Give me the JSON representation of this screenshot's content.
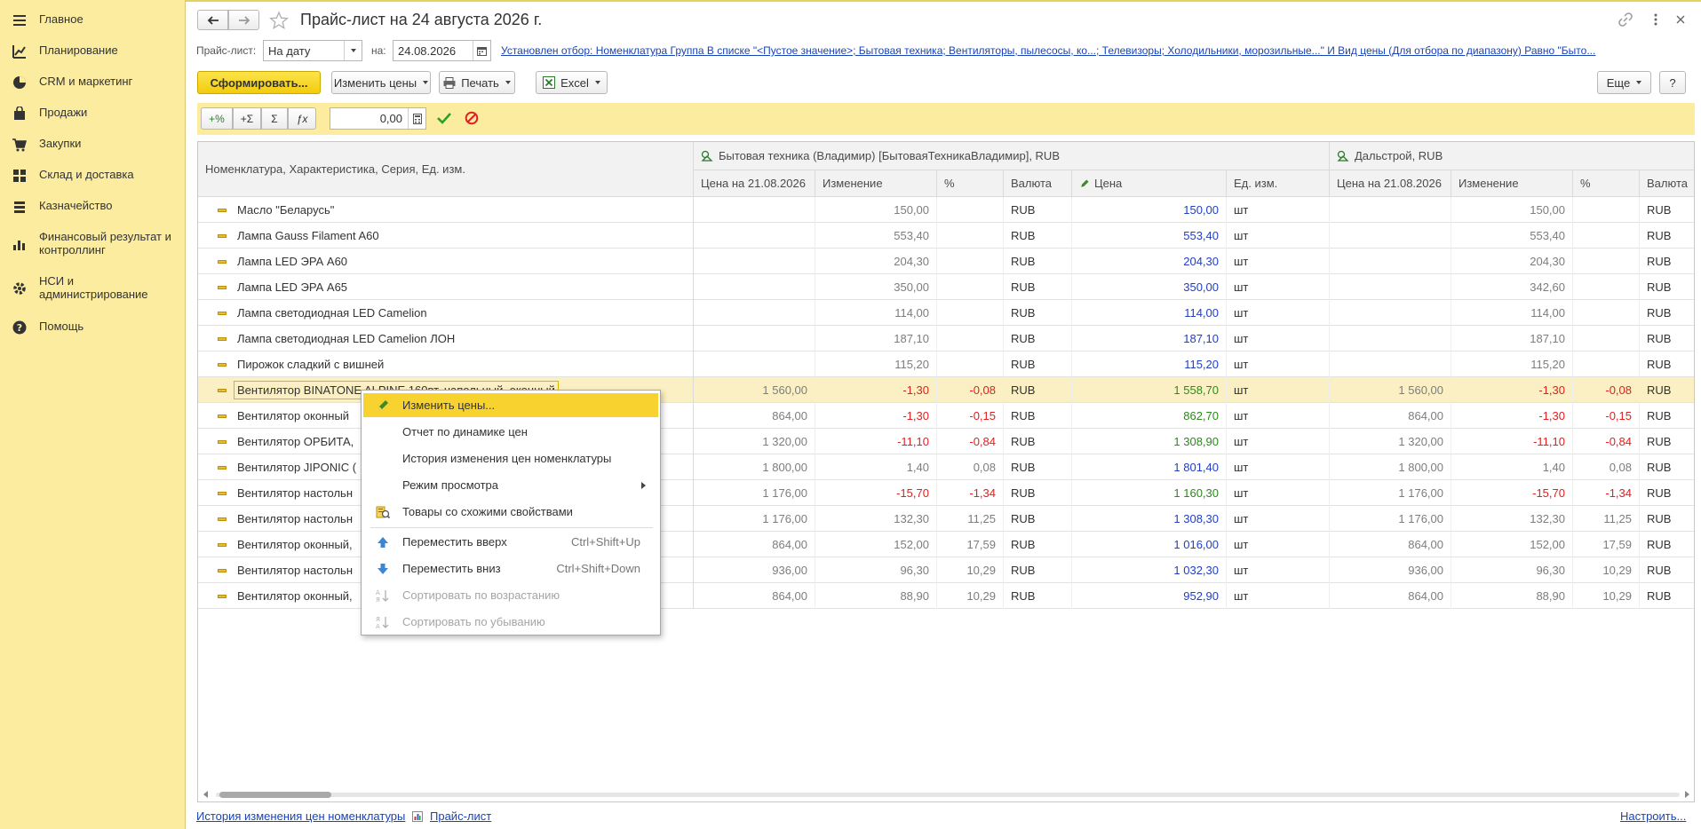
{
  "sidebar": {
    "items": [
      {
        "label": "Главное",
        "icon": "menu-icon"
      },
      {
        "label": "Планирование",
        "icon": "planning-icon"
      },
      {
        "label": "CRM и маркетинг",
        "icon": "crm-icon"
      },
      {
        "label": "Продажи",
        "icon": "bag-icon"
      },
      {
        "label": "Закупки",
        "icon": "cart-icon"
      },
      {
        "label": "Склад и доставка",
        "icon": "warehouse-icon"
      },
      {
        "label": "Казначейство",
        "icon": "treasury-icon"
      },
      {
        "label": "Финансовый результат и контроллинг",
        "icon": "chart-icon"
      },
      {
        "label": "НСИ и администрирование",
        "icon": "gear-icon"
      },
      {
        "label": "Помощь",
        "icon": "help-icon"
      }
    ]
  },
  "header": {
    "title": "Прайс-лист на 24 августа 2026 г."
  },
  "filter": {
    "pricelist_label": "Прайс-лист:",
    "pricelist_value": "На дату",
    "on_label": "на:",
    "date_value": "24.08.2026",
    "filter_text": "Установлен отбор: Номенклатура Группа В списке \"<Пустое значение>; Бытовая техника; Вентиляторы, пылесосы, ко...; Телевизоры; Холодильники, морозильные...\" И Вид цены (Для отбора по диапазону) Равно \"Быто..."
  },
  "toolbar": {
    "generate": "Сформировать...",
    "change_prices": "Изменить цены",
    "print": "Печать",
    "excel": "Excel",
    "more": "Еще",
    "help": "?"
  },
  "edit_bar": {
    "plus_percent": "+%",
    "plus_sum": "+Σ",
    "sum": "Σ",
    "fx": "ƒx",
    "value": "0,00"
  },
  "table": {
    "col_name": "Номенклатура, Характеристика, Серия, Ед. изм.",
    "group1": "Бытовая техника (Владимир) [БытоваяТехникаВладимир], RUB",
    "group2": "Дальстрой, RUB",
    "sub_headers": [
      "Цена на 21.08.2026",
      "Изменение",
      "%",
      "Валюта",
      "Цена",
      "Ед. изм."
    ],
    "sub_headers2": [
      "Цена на 21.08.2026",
      "Изменение",
      "%",
      "Валюта"
    ],
    "rows": [
      {
        "name": "Масло \"Беларусь\"",
        "old": "",
        "change": "150,00",
        "pct": "",
        "cur": "RUB",
        "price": "150,00",
        "unit": "шт",
        "old2": "",
        "change2": "150,00",
        "pct2": "",
        "cur2": "RUB",
        "kind": "plain"
      },
      {
        "name": "Лампа Gauss Filament A60",
        "old": "",
        "change": "553,40",
        "pct": "",
        "cur": "RUB",
        "price": "553,40",
        "unit": "шт",
        "old2": "",
        "change2": "553,40",
        "pct2": "",
        "cur2": "RUB",
        "kind": "plain"
      },
      {
        "name": "Лампа LED ЭРА A60",
        "old": "",
        "change": "204,30",
        "pct": "",
        "cur": "RUB",
        "price": "204,30",
        "unit": "шт",
        "old2": "",
        "change2": "204,30",
        "pct2": "",
        "cur2": "RUB",
        "kind": "plain"
      },
      {
        "name": "Лампа LED ЭРА A65",
        "old": "",
        "change": "350,00",
        "pct": "",
        "cur": "RUB",
        "price": "350,00",
        "unit": "шт",
        "old2": "",
        "change2": "342,60",
        "pct2": "",
        "cur2": "RUB",
        "kind": "plain"
      },
      {
        "name": "Лампа светодиодная LED Camelion",
        "old": "",
        "change": "114,00",
        "pct": "",
        "cur": "RUB",
        "price": "114,00",
        "unit": "шт",
        "old2": "",
        "change2": "114,00",
        "pct2": "",
        "cur2": "RUB",
        "kind": "plain"
      },
      {
        "name": "Лампа светодиодная LED Camelion ЛОН",
        "old": "",
        "change": "187,10",
        "pct": "",
        "cur": "RUB",
        "price": "187,10",
        "unit": "шт",
        "old2": "",
        "change2": "187,10",
        "pct2": "",
        "cur2": "RUB",
        "kind": "plain"
      },
      {
        "name": "Пирожок сладкий с вишней",
        "old": "",
        "change": "115,20",
        "pct": "",
        "cur": "RUB",
        "price": "115,20",
        "unit": "шт",
        "old2": "",
        "change2": "115,20",
        "pct2": "",
        "cur2": "RUB",
        "kind": "plain"
      },
      {
        "name": "Вентилятор BINATONE ALPINE 160вт, напольный, оконный",
        "old": "1 560,00",
        "change": "-1,30",
        "pct": "-0,08",
        "cur": "RUB",
        "price": "1 558,70",
        "unit": "шт",
        "old2": "1 560,00",
        "change2": "-1,30",
        "pct2": "-0,08",
        "cur2": "RUB",
        "kind": "down",
        "selected": true
      },
      {
        "name": "Вентилятор оконный",
        "old": "864,00",
        "change": "-1,30",
        "pct": "-0,15",
        "cur": "RUB",
        "price": "862,70",
        "unit": "шт",
        "old2": "864,00",
        "change2": "-1,30",
        "pct2": "-0,15",
        "cur2": "RUB",
        "kind": "down"
      },
      {
        "name": "Вентилятор ОРБИТА,",
        "old": "1 320,00",
        "change": "-11,10",
        "pct": "-0,84",
        "cur": "RUB",
        "price": "1 308,90",
        "unit": "шт",
        "old2": "1 320,00",
        "change2": "-11,10",
        "pct2": "-0,84",
        "cur2": "RUB",
        "kind": "down"
      },
      {
        "name": "Вентилятор JIPONIC (",
        "old": "1 800,00",
        "change": "1,40",
        "pct": "0,08",
        "cur": "RUB",
        "price": "1 801,40",
        "unit": "шт",
        "old2": "1 800,00",
        "change2": "1,40",
        "pct2": "0,08",
        "cur2": "RUB",
        "kind": "up"
      },
      {
        "name": "Вентилятор настольн",
        "old": "1 176,00",
        "change": "-15,70",
        "pct": "-1,34",
        "cur": "RUB",
        "price": "1 160,30",
        "unit": "шт",
        "old2": "1 176,00",
        "change2": "-15,70",
        "pct2": "-1,34",
        "cur2": "RUB",
        "kind": "down"
      },
      {
        "name": "Вентилятор настольн",
        "old": "1 176,00",
        "change": "132,30",
        "pct": "11,25",
        "cur": "RUB",
        "price": "1 308,30",
        "unit": "шт",
        "old2": "1 176,00",
        "change2": "132,30",
        "pct2": "11,25",
        "cur2": "RUB",
        "kind": "up"
      },
      {
        "name": "Вентилятор оконный,",
        "old": "864,00",
        "change": "152,00",
        "pct": "17,59",
        "cur": "RUB",
        "price": "1 016,00",
        "unit": "шт",
        "old2": "864,00",
        "change2": "152,00",
        "pct2": "17,59",
        "cur2": "RUB",
        "kind": "up"
      },
      {
        "name": "Вентилятор настольн",
        "old": "936,00",
        "change": "96,30",
        "pct": "10,29",
        "cur": "RUB",
        "price": "1 032,30",
        "unit": "шт",
        "old2": "936,00",
        "change2": "96,30",
        "pct2": "10,29",
        "cur2": "RUB",
        "kind": "up"
      },
      {
        "name": "Вентилятор оконный,",
        "old": "864,00",
        "change": "88,90",
        "pct": "10,29",
        "cur": "RUB",
        "price": "952,90",
        "unit": "шт",
        "old2": "864,00",
        "change2": "88,90",
        "pct2": "10,29",
        "cur2": "RUB",
        "kind": "up"
      }
    ]
  },
  "context_menu": {
    "items": [
      {
        "label": "Изменить цены...",
        "shortcut": "",
        "icon": "pencil-icon",
        "state": "hover"
      },
      {
        "label": "Отчет по динамике цен",
        "shortcut": "",
        "icon": "",
        "state": "normal"
      },
      {
        "label": "История изменения цен номенклатуры",
        "shortcut": "",
        "icon": "",
        "state": "normal"
      },
      {
        "label": "Режим просмотра",
        "shortcut": "",
        "icon": "",
        "state": "submenu"
      },
      {
        "label": "Товары со схожими свойствами",
        "shortcut": "",
        "icon": "similar-goods-icon",
        "state": "normal"
      },
      {
        "label": "Переместить вверх",
        "shortcut": "Ctrl+Shift+Up",
        "icon": "arrow-up-icon",
        "state": "normal"
      },
      {
        "label": "Переместить вниз",
        "shortcut": "Ctrl+Shift+Down",
        "icon": "arrow-down-icon",
        "state": "normal"
      },
      {
        "label": "Сортировать по возрастанию",
        "shortcut": "",
        "icon": "sort-asc-icon",
        "state": "disabled"
      },
      {
        "label": "Сортировать по убыванию",
        "shortcut": "",
        "icon": "sort-desc-icon",
        "state": "disabled"
      }
    ]
  },
  "footer": {
    "history_link": "История изменения цен номенклатуры",
    "pricelist_link": "Прайс-лист",
    "configure_link": "Настроить..."
  },
  "colors": {
    "sidebar_bg": "#FBEC9F",
    "accent_yellow": "#F5D21F",
    "negative": "#E02020",
    "positive": "#2B8A1A",
    "price_blue": "#1F3EC8",
    "link": "#1A44B8"
  }
}
